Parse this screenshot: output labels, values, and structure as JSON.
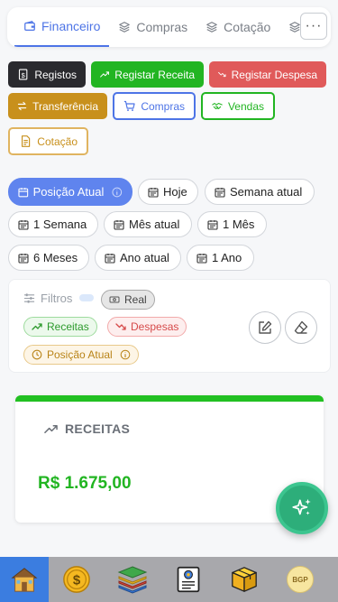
{
  "topnav": {
    "tabs": [
      {
        "label": "Financeiro",
        "icon": "wallet-icon"
      },
      {
        "label": "Compras",
        "icon": "layers-icon"
      },
      {
        "label": "Cotação",
        "icon": "layers-icon"
      }
    ],
    "more_label": "···"
  },
  "actions": {
    "registos": "Registos",
    "registar_receita": "Registar Receita",
    "registar_despesa": "Registar Despesa",
    "transferencia": "Transferência",
    "compras": "Compras",
    "vendas": "Vendas",
    "cotacao": "Cotação"
  },
  "periods": {
    "posicao_atual": "Posição Atual",
    "hoje": "Hoje",
    "semana_atual": "Semana atual",
    "semana_1": "1 Semana",
    "mes_atual": "Mês atual",
    "mes_1": "1 Mês",
    "meses_6": "6 Meses",
    "ano_atual": "Ano atual",
    "ano_1": "1 Ano"
  },
  "filters": {
    "title": "Filtros",
    "real": "Real",
    "receitas": "Receitas",
    "despesas": "Despesas",
    "posicao_atual": "Posição Atual"
  },
  "receitas_card": {
    "title": "RECEITAS",
    "value": "R$ 1.675,00"
  },
  "bottombar": {
    "avatar_initials": "BGP"
  },
  "colors": {
    "primary": "#4d74e6",
    "green": "#22c022",
    "red": "#e05a5a",
    "gold": "#c8901c",
    "dark": "#2a2a2e",
    "fab": "#2dae7a"
  }
}
